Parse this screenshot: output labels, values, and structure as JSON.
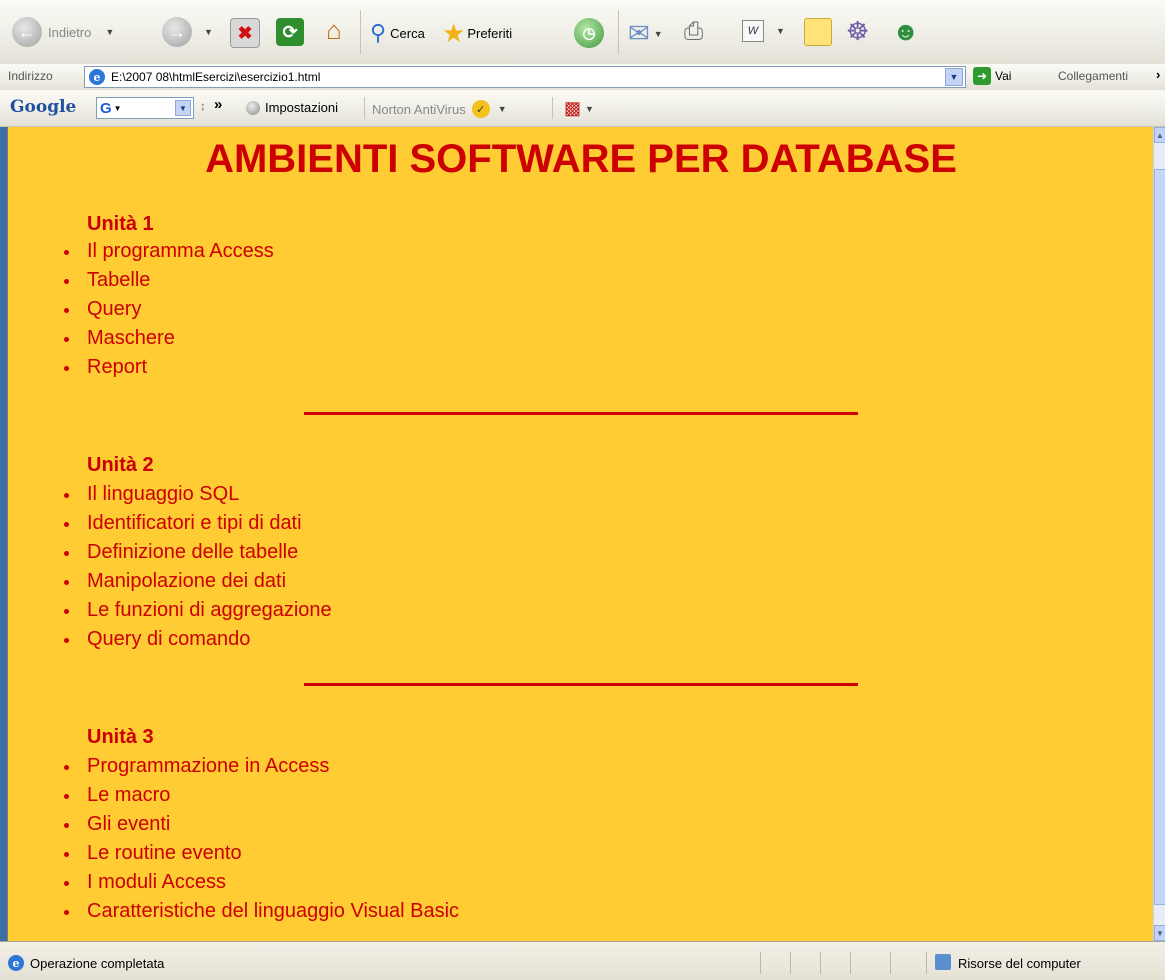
{
  "toolbar": {
    "back_label": "Indietro",
    "search_label": "Cerca",
    "favorites_label": "Preferiti"
  },
  "address_bar": {
    "label": "Indirizzo",
    "url": "E:\\2007 08\\htmlEsercizi\\esercizio1.html",
    "go_label": "Vai",
    "links_label": "Collegamenti"
  },
  "google_bar": {
    "logo": "Google",
    "settings_label": "Impostazioni",
    "norton_label": "Norton AntiVirus"
  },
  "page": {
    "title": "AMBIENTI SOFTWARE PER DATABASE",
    "units": [
      {
        "title": "Unità 1",
        "items": [
          "Il programma Access",
          "Tabelle",
          "Query",
          "Maschere",
          "Report"
        ]
      },
      {
        "title": "Unità 2",
        "items": [
          "Il linguaggio SQL",
          "Identificatori e tipi di dati",
          "Definizione delle tabelle",
          "Manipolazione dei dati",
          "Le funzioni di aggregazione",
          "Query di comando"
        ]
      },
      {
        "title": "Unità 3",
        "items": [
          "Programmazione in Access",
          "Le macro",
          "Gli eventi",
          "Le routine evento",
          "I moduli Access",
          "Caratteristiche del linguaggio Visual Basic"
        ]
      }
    ]
  },
  "status": {
    "text": "Operazione completata",
    "zone": "Risorse del computer"
  },
  "colors": {
    "page_background": "#ffcc33",
    "text_red": "#cc0000"
  }
}
